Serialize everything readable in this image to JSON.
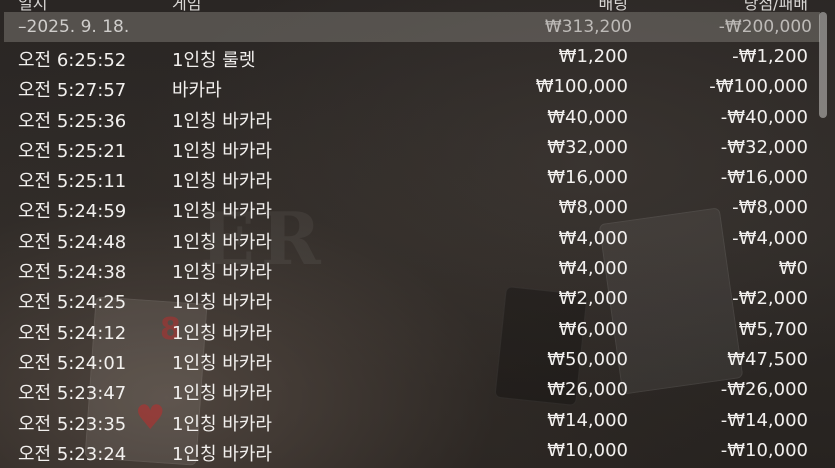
{
  "header": {
    "date_col": "일시",
    "game_col": "게임",
    "bet_col": "배팅",
    "win_col": "당첨/패배"
  },
  "group": {
    "date": "–2025. 9. 18.",
    "bet_total": "₩313,200",
    "win_total": "-₩200,000"
  },
  "rows": [
    {
      "time": "오전 6:25:52",
      "game": "1인칭 룰렛",
      "bet": "₩1,200",
      "result": "-₩1,200"
    },
    {
      "time": "오전 5:27:57",
      "game": "바카라",
      "bet": "₩100,000",
      "result": "-₩100,000"
    },
    {
      "time": "오전 5:25:36",
      "game": "1인칭 바카라",
      "bet": "₩40,000",
      "result": "-₩40,000"
    },
    {
      "time": "오전 5:25:21",
      "game": "1인칭 바카라",
      "bet": "₩32,000",
      "result": "-₩32,000"
    },
    {
      "time": "오전 5:25:11",
      "game": "1인칭 바카라",
      "bet": "₩16,000",
      "result": "-₩16,000"
    },
    {
      "time": "오전 5:24:59",
      "game": "1인칭 바카라",
      "bet": "₩8,000",
      "result": "-₩8,000"
    },
    {
      "time": "오전 5:24:48",
      "game": "1인칭 바카라",
      "bet": "₩4,000",
      "result": "-₩4,000"
    },
    {
      "time": "오전 5:24:38",
      "game": "1인칭 바카라",
      "bet": "₩4,000",
      "result": "₩0"
    },
    {
      "time": "오전 5:24:25",
      "game": "1인칭 바카라",
      "bet": "₩2,000",
      "result": "-₩2,000"
    },
    {
      "time": "오전 5:24:12",
      "game": "1인칭 바카라",
      "bet": "₩6,000",
      "result": "₩5,700"
    },
    {
      "time": "오전 5:24:01",
      "game": "1인칭 바카라",
      "bet": "₩50,000",
      "result": "₩47,500"
    },
    {
      "time": "오전 5:23:47",
      "game": "1인칭 바카라",
      "bet": "₩26,000",
      "result": "-₩26,000"
    },
    {
      "time": "오전 5:23:35",
      "game": "1인칭 바카라",
      "bet": "₩14,000",
      "result": "-₩14,000"
    },
    {
      "time": "오전 5:23:24",
      "game": "1인칭 바카라",
      "bet": "₩10,000",
      "result": "-₩10,000"
    }
  ]
}
